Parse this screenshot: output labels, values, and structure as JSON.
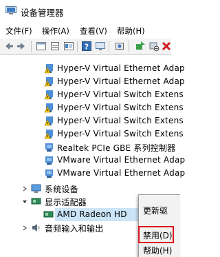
{
  "window": {
    "title": "设备管理器"
  },
  "menu": [
    "文件(F)",
    "操作(A)",
    "查看(V)",
    "帮助(H)"
  ],
  "toolbar": {
    "buttons": [
      "back-arrow-icon",
      "forward-arrow-icon",
      "properties-icon",
      "show-hidden-icon",
      "help-icon",
      "view-icon",
      "computer-icon",
      "update-driver-icon",
      "uninstall-icon",
      "scan-hardware-icon"
    ]
  },
  "tree": {
    "network_adapters": [
      "Hyper-V Virtual Ethernet Adap",
      "Hyper-V Virtual Ethernet Adap",
      "Hyper-V Virtual Switch Extens",
      "Hyper-V Virtual Switch Extens",
      "Hyper-V Virtual Switch Extens",
      "Hyper-V Virtual Switch Extens",
      "Realtek PCIe GBE 系列控制器",
      "VMware Virtual Ethernet Adap",
      "VMware Virtual Ethernet Adap"
    ],
    "system_devices": "系统设备",
    "display_adapters": "显示适配器",
    "display_device": "AMD Radeon HD",
    "audio": "音频输入和输出"
  },
  "context_menu": {
    "update_driver": "更新驱",
    "disable": "禁用(D)",
    "help": "帮助(H)"
  }
}
